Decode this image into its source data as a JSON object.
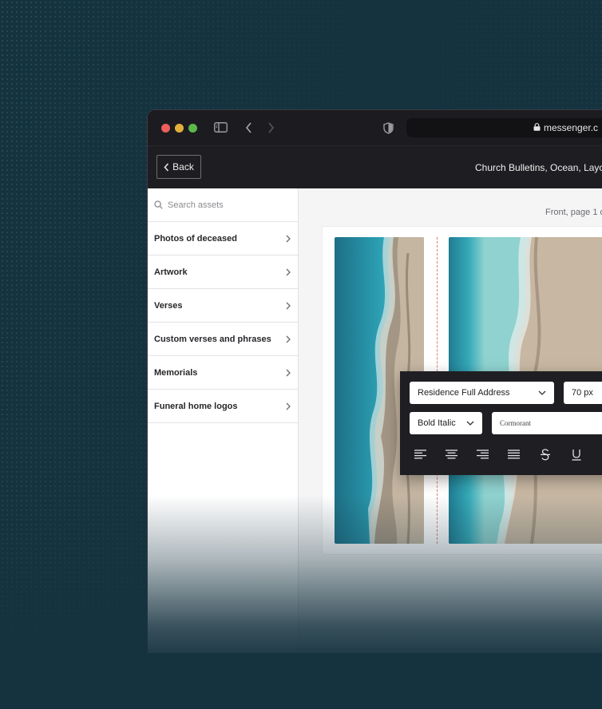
{
  "browser": {
    "url": "messenger.c"
  },
  "app": {
    "back_label": "Back",
    "document_title": "Church Bulletins, Ocean, Layout"
  },
  "sidebar": {
    "search_placeholder": "Search assets",
    "items": [
      {
        "label": "Photos of deceased"
      },
      {
        "label": "Artwork"
      },
      {
        "label": "Verses"
      },
      {
        "label": "Custom verses and phrases"
      },
      {
        "label": "Memorials"
      },
      {
        "label": "Funeral home logos"
      }
    ]
  },
  "canvas": {
    "page_label": "Front, page 1 o"
  },
  "text_toolbar": {
    "field": "Residence Full Address",
    "size": "70 px",
    "style": "Bold Italic",
    "font": "Cormorant",
    "format_icons": [
      "align-left-icon",
      "align-center-icon",
      "align-right-icon",
      "align-justify-icon",
      "strikethrough-icon",
      "underline-icon"
    ]
  },
  "colors": {
    "background": "#15323f",
    "window": "#1b1b1f",
    "accent_fold": "#e07a6b"
  }
}
